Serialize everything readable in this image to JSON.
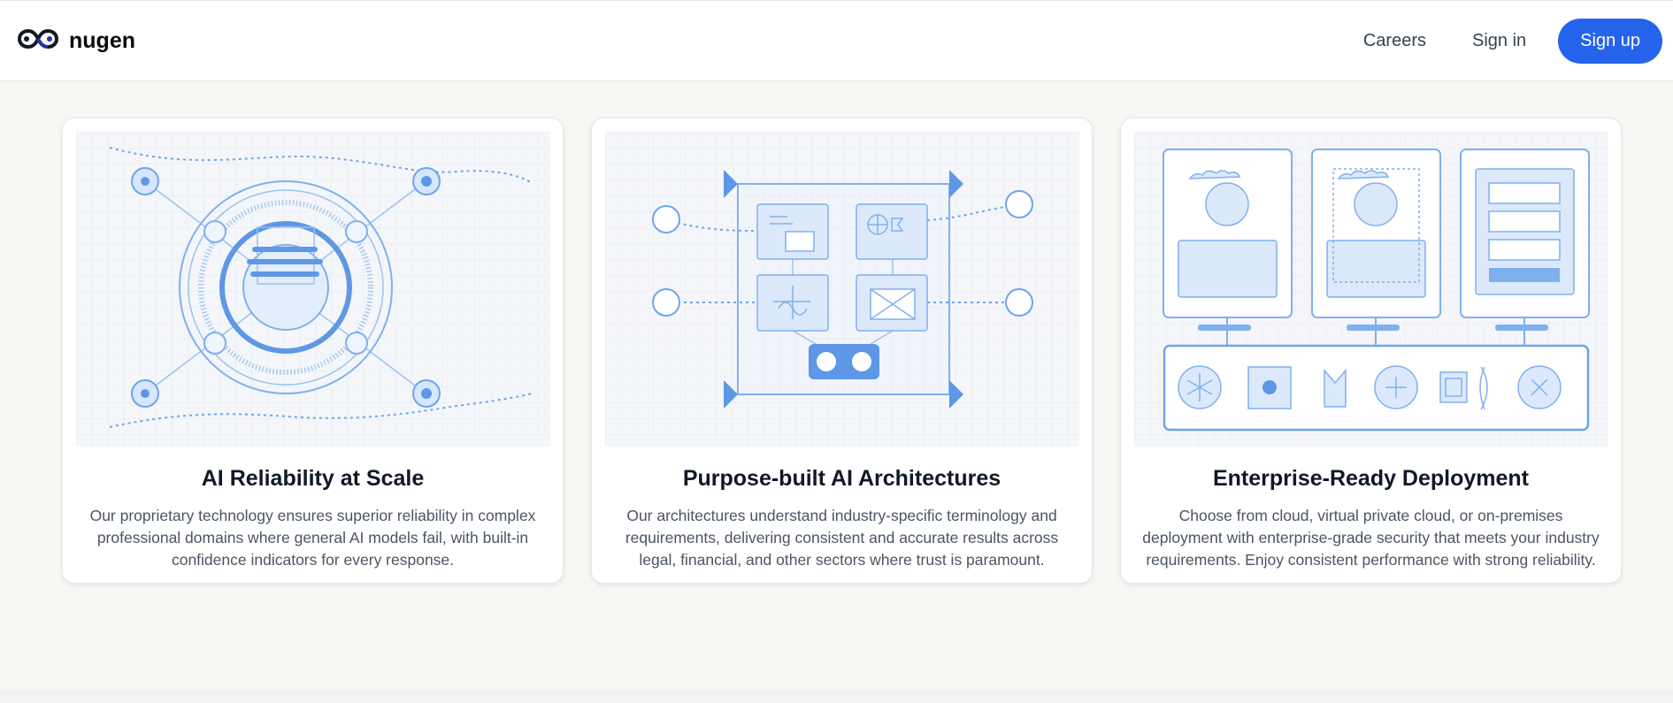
{
  "header": {
    "brand_name": "nugen",
    "logo_icon": "infinity-loop-icon",
    "nav": {
      "careers": "Careers",
      "signin": "Sign in",
      "signup": "Sign up"
    },
    "accent_color": "#2563eb"
  },
  "cards": [
    {
      "title": "AI Reliability at Scale",
      "description": "Our proprietary technology ensures superior reliability in complex professional domains where general AI models fail, with built-in confidence indicators for every response.",
      "illustration_icon": "reliability-target-icon"
    },
    {
      "title": "Purpose-built AI Architectures",
      "description": "Our architectures understand industry-specific terminology and requirements, delivering consistent and accurate results across legal, financial, and other sectors where trust is paramount.",
      "illustration_icon": "architecture-grid-icon"
    },
    {
      "title": "Enterprise-Ready Deployment",
      "description": "Choose from cloud, virtual private cloud, or on-premises deployment with enterprise-grade security that meets your industry requirements. Enjoy consistent performance with strong reliability.",
      "illustration_icon": "deployment-screens-icon"
    }
  ]
}
